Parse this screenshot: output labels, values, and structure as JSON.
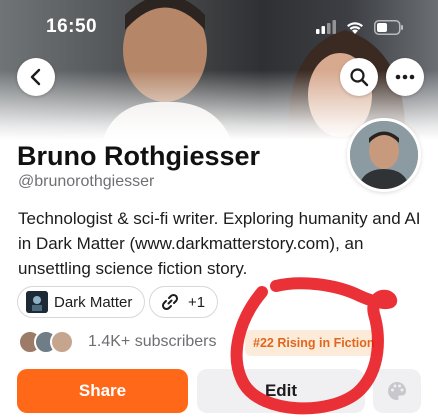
{
  "status_bar": {
    "time": "16:50"
  },
  "nav": {
    "back_icon": "chevron-left-icon",
    "search_icon": "search-icon",
    "more_icon": "ellipsis-icon"
  },
  "profile": {
    "name": "Bruno Rothgiesser",
    "handle": "@brunorothgiesser",
    "bio": "Technologist & sci-fi writer. Exploring humanity and AI in Dark Matter (www.darkmatterstory.com), an unsettling science fiction story."
  },
  "chips": {
    "publication": "Dark Matter",
    "links_count": "+1"
  },
  "subscribers": {
    "text": "1.4K+ subscribers"
  },
  "badge": {
    "text": "#22 Rising in Fiction"
  },
  "actions": {
    "share_label": "Share",
    "edit_label": "Edit",
    "palette_icon": "palette-icon"
  },
  "colors": {
    "accent": "#ff6719",
    "badge_bg": "#fdebd9",
    "badge_text": "#e0671d",
    "annotation": "#e8141c"
  }
}
